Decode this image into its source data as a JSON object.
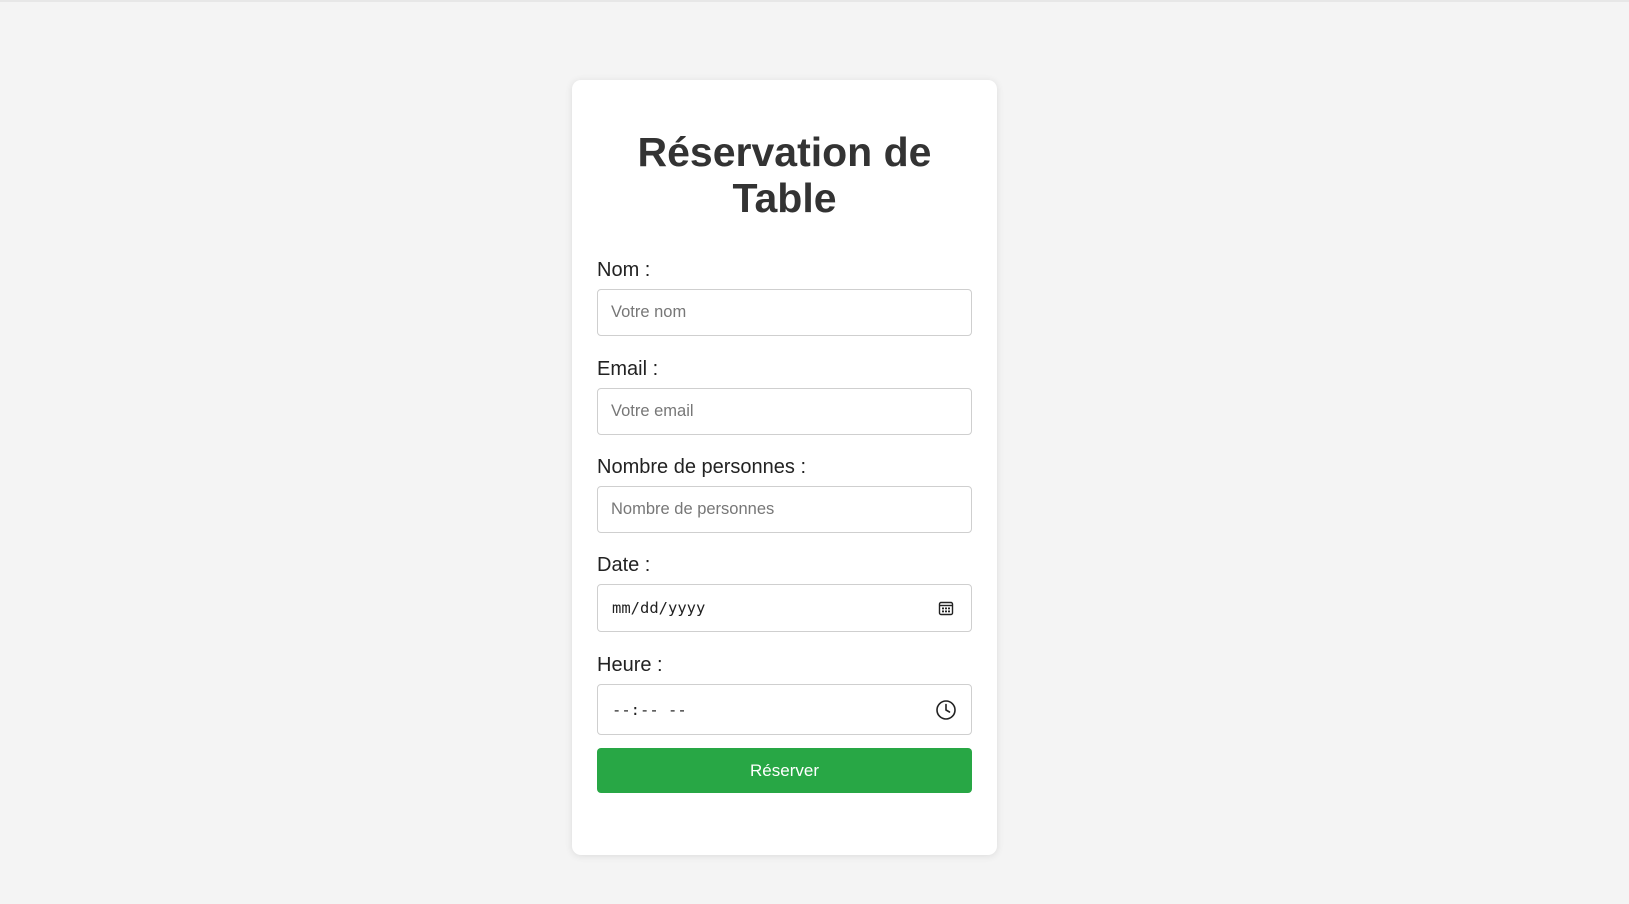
{
  "form": {
    "title": "Réservation de Table",
    "fields": {
      "name": {
        "label": "Nom :",
        "placeholder": "Votre nom",
        "value": ""
      },
      "email": {
        "label": "Email :",
        "placeholder": "Votre email",
        "value": ""
      },
      "guests": {
        "label": "Nombre de personnes :",
        "placeholder": "Nombre de personnes",
        "value": ""
      },
      "date": {
        "label": "Date :",
        "display": "mm/dd/yyyy",
        "icon": "calendar-icon"
      },
      "time": {
        "label": "Heure :",
        "display": "--:-- --",
        "icon": "clock-icon"
      }
    },
    "submit_label": "Réserver"
  },
  "colors": {
    "background": "#f4f4f4",
    "card": "#ffffff",
    "title": "#333333",
    "submit": "#28a745",
    "submit_text": "#ffffff"
  }
}
